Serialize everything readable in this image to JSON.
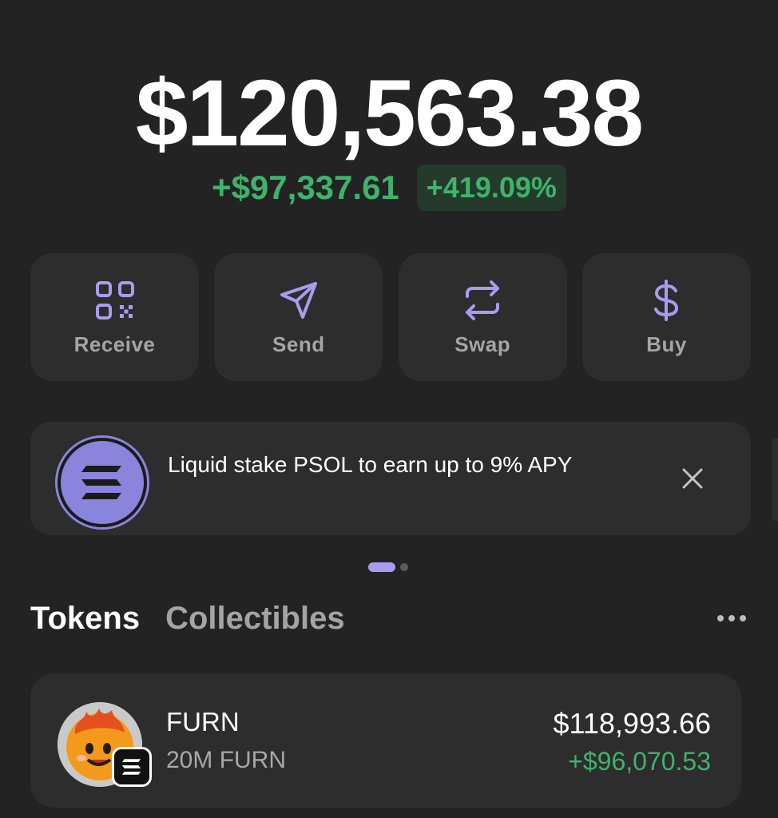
{
  "wallet": {
    "balance": "$120,563.38",
    "change_amount": "+$97,337.61",
    "change_percent": "+419.09%"
  },
  "actions": [
    {
      "label": "Receive",
      "icon": "qr-code-icon"
    },
    {
      "label": "Send",
      "icon": "send-icon"
    },
    {
      "label": "Swap",
      "icon": "swap-icon"
    },
    {
      "label": "Buy",
      "icon": "dollar-icon"
    }
  ],
  "banner": {
    "text": "Liquid stake PSOL to earn up to 9% APY",
    "icon": "solana-logo-icon"
  },
  "carousel": {
    "page": 1,
    "total": 2
  },
  "tabs": [
    {
      "label": "Tokens",
      "active": true
    },
    {
      "label": "Collectibles",
      "active": false
    }
  ],
  "tokens": [
    {
      "name": "FURN",
      "amount": "20M FURN",
      "value": "$118,993.66",
      "change": "+$96,070.53"
    }
  ],
  "colors": {
    "background": "#232323",
    "card": "#2d2d2d",
    "accent": "#a99cf0",
    "positive": "#3fb36b"
  }
}
